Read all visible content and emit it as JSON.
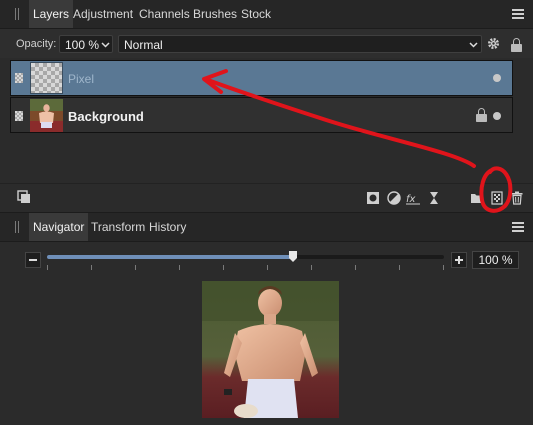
{
  "layers_panel": {
    "tabs": [
      {
        "label": "Layers"
      },
      {
        "label": "Adjustment"
      },
      {
        "label": "Channels"
      },
      {
        "label": "Brushes"
      },
      {
        "label": "Stock"
      }
    ],
    "opacity_label": "Opacity:",
    "opacity_value": "100 %",
    "blend_mode": "Normal",
    "layers": [
      {
        "name": "Pixel",
        "selected": true
      },
      {
        "name": "Background",
        "selected": false,
        "locked": true
      }
    ]
  },
  "navigator_panel": {
    "tabs": [
      {
        "label": "Navigator"
      },
      {
        "label": "Transform"
      },
      {
        "label": "History"
      }
    ],
    "zoom_value": "100 %",
    "zoom_slider_fraction": 0.62
  },
  "colors": {
    "selected_layer": "#5a7894",
    "annotation": "#e0141b",
    "slider_fill": "#6f8fb8"
  },
  "icons": [
    "panel-grip-icon",
    "hamburger-menu-icon",
    "chevron-down-icon",
    "gear-icon",
    "lock-icon",
    "layer-handle-icon",
    "visibility-dot-icon",
    "new-document-icon",
    "mask-icon",
    "adjustment-icon",
    "fx-icon",
    "hourglass-icon",
    "folder-icon",
    "pixel-layer-icon",
    "trash-icon",
    "minus-icon",
    "plus-icon"
  ]
}
